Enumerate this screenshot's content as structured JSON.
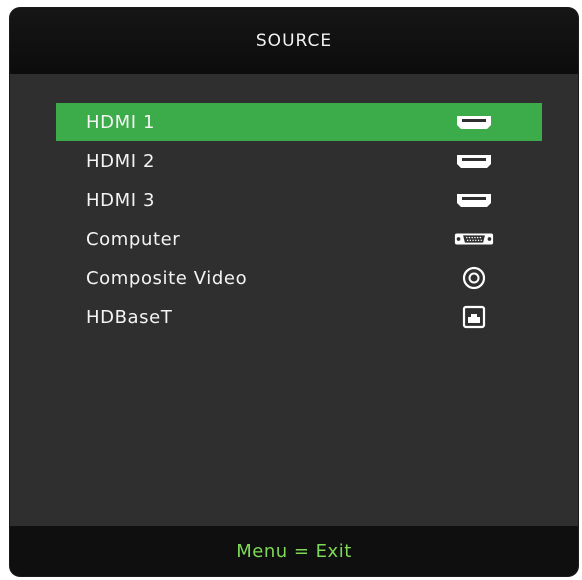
{
  "header": {
    "title": "SOURCE"
  },
  "sources": [
    {
      "label": "HDMI 1",
      "icon": "hdmi-port-icon",
      "selected": true
    },
    {
      "label": "HDMI 2",
      "icon": "hdmi-port-icon",
      "selected": false
    },
    {
      "label": "HDMI 3",
      "icon": "hdmi-port-icon",
      "selected": false
    },
    {
      "label": "Computer",
      "icon": "vga-port-icon",
      "selected": false
    },
    {
      "label": "Composite Video",
      "icon": "rca-port-icon",
      "selected": false
    },
    {
      "label": "HDBaseT",
      "icon": "rj45-port-icon",
      "selected": false
    }
  ],
  "footer": {
    "hint": "Menu = Exit"
  },
  "colors": {
    "panel": "#2f2f2f",
    "header": "#111111",
    "footer": "#0f0f0f",
    "selection": "#3cab49",
    "footer_text": "#7ed957",
    "text": "#f4f4f4"
  }
}
